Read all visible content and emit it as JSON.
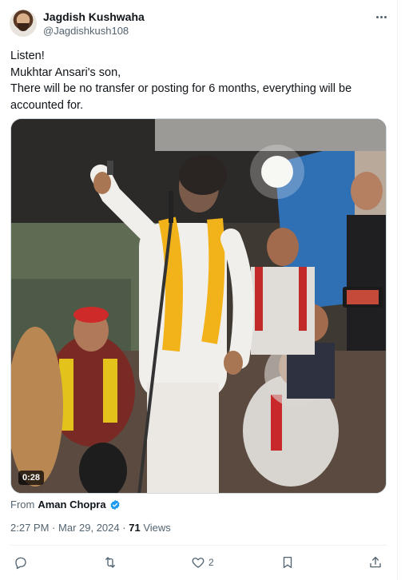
{
  "post": {
    "author": {
      "display_name": "Jagdish Kushwaha",
      "handle": "@Jagdishkush108"
    },
    "text_lines": [
      "Listen!",
      "Mukhtar Ansari's son,",
      "There will be no transfer or posting for 6 months, everything will be",
      "accounted for."
    ],
    "video": {
      "duration": "0:28"
    },
    "from": {
      "label": "From",
      "source": "Aman Chopra",
      "verified": true
    },
    "meta": {
      "time": "2:27 PM",
      "separator": "·",
      "date": "Mar 29, 2024",
      "views_count": "71",
      "views_label": "Views"
    },
    "actions": {
      "reply_count": "",
      "repost_count": "",
      "like_count": "2",
      "bookmark_count": "",
      "share_count": ""
    }
  },
  "icons": {
    "more": "more-horizontal-icon",
    "verified": "verified-badge-icon",
    "reply": "reply-icon",
    "repost": "repost-icon",
    "like": "heart-icon",
    "bookmark": "bookmark-icon",
    "share": "share-icon"
  },
  "colors": {
    "text_primary": "#0f1419",
    "text_secondary": "#536471",
    "verified_blue": "#1d9bf0",
    "divider": "#eff3f4"
  }
}
